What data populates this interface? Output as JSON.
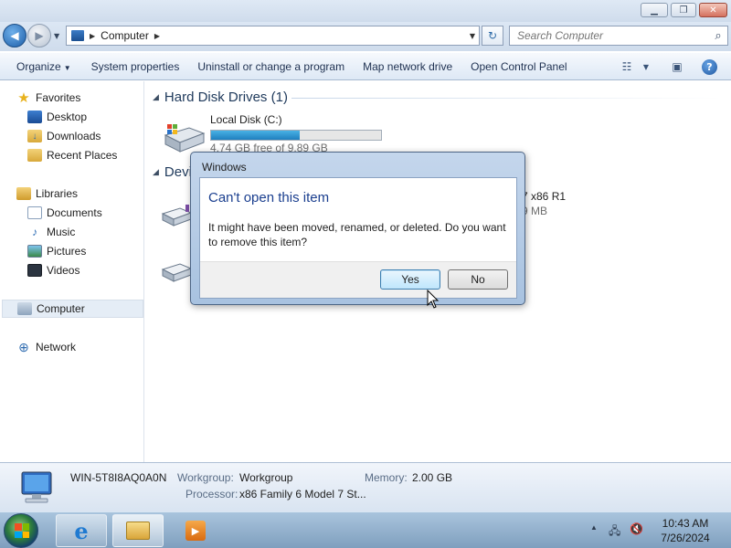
{
  "window": {
    "minimize_icon": "minimize-icon",
    "maximize_icon": "maximize-icon",
    "close_icon": "close-icon"
  },
  "address": {
    "path": "Computer",
    "search_placeholder": "Search Computer"
  },
  "toolbar": {
    "organize": "Organize",
    "system_properties": "System properties",
    "uninstall": "Uninstall or change a program",
    "map_network": "Map network drive",
    "open_control_panel": "Open Control Panel"
  },
  "nav": {
    "favorites": "Favorites",
    "desktop": "Desktop",
    "downloads": "Downloads",
    "recent_places": "Recent Places",
    "libraries": "Libraries",
    "documents": "Documents",
    "music": "Music",
    "pictures": "Pictures",
    "videos": "Videos",
    "computer": "Computer",
    "network": "Network"
  },
  "content": {
    "hard_disk_header": "Hard Disk Drives (1)",
    "devices_header_partial": "Devi",
    "local_disk": {
      "label": "Local Disk (C:)",
      "free_text": "4.74 GB free of 9.89 GB",
      "used_fraction": 0.52
    },
    "dvd_label_partial": "7 x86 R1",
    "dvd_size_partial": "9 MB"
  },
  "details": {
    "computer_name": "WIN-5T8I8AQ0A0N",
    "workgroup_label": "Workgroup:",
    "workgroup_value": "Workgroup",
    "memory_label": "Memory:",
    "memory_value": "2.00 GB",
    "processor_label": "Processor:",
    "processor_value": "x86 Family 6 Model 7 St..."
  },
  "dialog": {
    "title": "Windows",
    "heading": "Can't open this item",
    "message": "It might have been moved, renamed, or deleted. Do you want to remove this item?",
    "yes": "Yes",
    "no": "No"
  },
  "taskbar": {
    "time": "10:43 AM",
    "date": "7/26/2024"
  }
}
